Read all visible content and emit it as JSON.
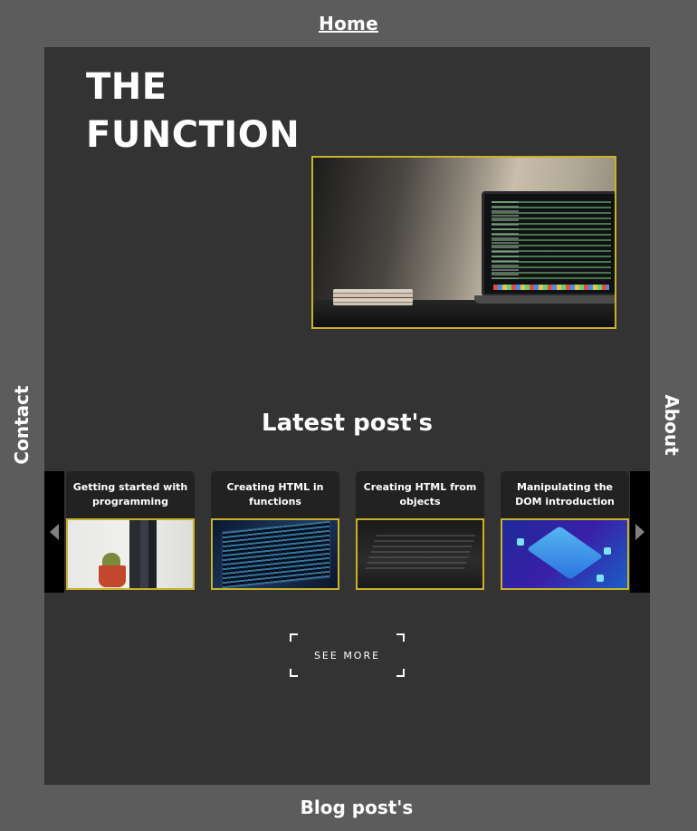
{
  "nav": {
    "home": "Home",
    "about": "About",
    "contact": "Contact",
    "blog": "Blog post's"
  },
  "site": {
    "title_line1": "THE",
    "title_line2": "FUNCTION"
  },
  "latest": {
    "heading": "Latest post's",
    "posts": [
      {
        "title": "Getting started with programming"
      },
      {
        "title": "Creating HTML in functions"
      },
      {
        "title": "Creating HTML from objects"
      },
      {
        "title": "Manipulating the DOM introduction"
      }
    ],
    "see_more": "SEE MORE"
  },
  "colors": {
    "background": "#5c5c5c",
    "panel": "#333333",
    "accent_border": "#c9b12a"
  },
  "icons": {
    "prev": "chevron-left-icon",
    "next": "chevron-right-icon"
  }
}
